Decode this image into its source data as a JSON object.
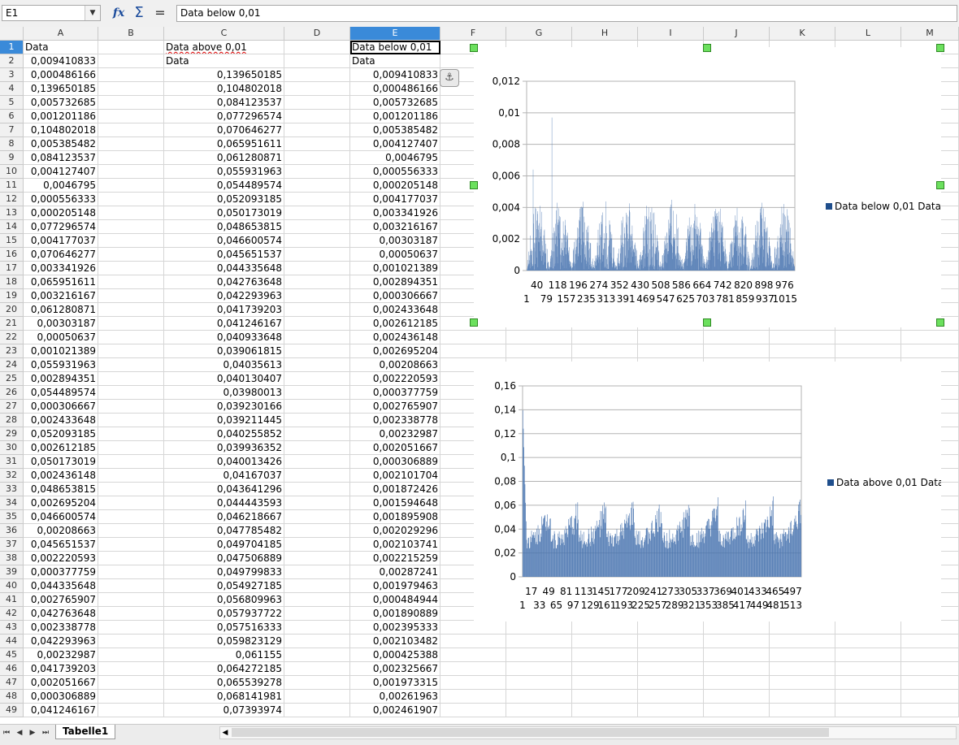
{
  "formula_bar": {
    "cell_ref": "E1",
    "content": "Data below 0,01",
    "dropdown_icon": "chevron-down-icon",
    "function_wizard_icon": "fx-icon",
    "sum_icon": "sigma-icon",
    "equals_icon": "equals-icon"
  },
  "columns": [
    "A",
    "B",
    "C",
    "D",
    "E",
    "F",
    "G",
    "H",
    "I",
    "J",
    "K",
    "L",
    "M"
  ],
  "selected_column": "E",
  "selected_row": "1",
  "row_numbers": [
    "1",
    "2",
    "3",
    "4",
    "5",
    "6",
    "7",
    "8",
    "9",
    "10",
    "11",
    "12",
    "13",
    "14",
    "15",
    "16",
    "17",
    "18",
    "19",
    "20",
    "21",
    "22",
    "23",
    "24",
    "25",
    "26",
    "27",
    "28",
    "29",
    "30",
    "31",
    "32",
    "33",
    "34",
    "35",
    "36",
    "37",
    "38",
    "39",
    "40",
    "41",
    "42",
    "43",
    "44",
    "45",
    "46",
    "47",
    "48",
    "49"
  ],
  "header_cells": {
    "a1": "Data",
    "c1": "Data above 0,01",
    "e1": "Data below 0,01",
    "c2": "Data",
    "e2": "Data",
    "a2": "0,009410833"
  },
  "column_a": [
    "0,000486166",
    "0,139650185",
    "0,005732685",
    "0,001201186",
    "0,104802018",
    "0,005385482",
    "0,084123537",
    "0,004127407",
    "0,0046795",
    "0,000556333",
    "0,000205148",
    "0,077296574",
    "0,004177037",
    "0,070646277",
    "0,003341926",
    "0,065951611",
    "0,003216167",
    "0,061280871",
    "0,00303187",
    "0,00050637",
    "0,001021389",
    "0,055931963",
    "0,002894351",
    "0,054489574",
    "0,000306667",
    "0,002433648",
    "0,052093185",
    "0,002612185",
    "0,050173019",
    "0,002436148",
    "0,048653815",
    "0,002695204",
    "0,046600574",
    "0,00208663",
    "0,045651537",
    "0,002220593",
    "0,000377759",
    "0,044335648",
    "0,002765907",
    "0,042763648",
    "0,002338778",
    "0,042293963",
    "0,00232987",
    "0,041739203",
    "0,002051667",
    "0,000306889",
    "0,041246167"
  ],
  "column_c": [
    "0,139650185",
    "0,104802018",
    "0,084123537",
    "0,077296574",
    "0,070646277",
    "0,065951611",
    "0,061280871",
    "0,055931963",
    "0,054489574",
    "0,052093185",
    "0,050173019",
    "0,048653815",
    "0,046600574",
    "0,045651537",
    "0,044335648",
    "0,042763648",
    "0,042293963",
    "0,041739203",
    "0,041246167",
    "0,040933648",
    "0,039061815",
    "0,04035613",
    "0,040130407",
    "0,03980013",
    "0,039230166",
    "0,039211445",
    "0,040255852",
    "0,039936352",
    "0,040013426",
    "0,04167037",
    "0,043641296",
    "0,044443593",
    "0,046218667",
    "0,047785482",
    "0,049704185",
    "0,047506889",
    "0,049799833",
    "0,054927185",
    "0,056809963",
    "0,057937722",
    "0,057516333",
    "0,059823129",
    "0,061155",
    "0,064272185",
    "0,065539278",
    "0,068141981",
    "0,07393974"
  ],
  "column_e": [
    "0,009410833",
    "0,000486166",
    "0,005732685",
    "0,001201186",
    "0,005385482",
    "0,004127407",
    "0,0046795",
    "0,000556333",
    "0,000205148",
    "0,004177037",
    "0,003341926",
    "0,003216167",
    "0,00303187",
    "0,00050637",
    "0,001021389",
    "0,002894351",
    "0,000306667",
    "0,002433648",
    "0,002612185",
    "0,002436148",
    "0,002695204",
    "0,00208663",
    "0,002220593",
    "0,000377759",
    "0,002765907",
    "0,002338778",
    "0,00232987",
    "0,002051667",
    "0,000306889",
    "0,002101704",
    "0,001872426",
    "0,001594648",
    "0,001895908",
    "0,002029296",
    "0,002103741",
    "0,002215259",
    "0,00287241",
    "0,001979463",
    "0,000484944",
    "0,001890889",
    "0,002395333",
    "0,002103482",
    "0,000425388",
    "0,002325667",
    "0,001973315",
    "0,00261963",
    "0,002461907"
  ],
  "sheet": {
    "tab_name": "Tabelle1",
    "nav_icons": [
      "first-sheet-icon",
      "prev-sheet-icon",
      "next-sheet-icon",
      "last-sheet-icon"
    ]
  },
  "colors": {
    "series": "#4a75b0",
    "legend_marker": "#1f4e8c",
    "selection": "#3a8ad9",
    "handle": "#6ce05e"
  },
  "chart_data": [
    {
      "type": "bar",
      "legend": "Data below 0,01 Data",
      "legend_position": "right",
      "ylim": [
        0,
        0.012
      ],
      "yticks": [
        "0,012",
        "0,01",
        "0,008",
        "0,006",
        "0,004",
        "0,002",
        "0"
      ],
      "xticks_row1": [
        "40",
        "118",
        "196",
        "274",
        "352",
        "430",
        "508",
        "586",
        "664",
        "742",
        "820",
        "898",
        "976"
      ],
      "xticks_row2": [
        "1",
        "79",
        "157",
        "235",
        "313",
        "391",
        "469",
        "547",
        "625",
        "703",
        "781",
        "859",
        "937",
        "1015"
      ],
      "n_points": 1015,
      "pattern": {
        "periods": 12,
        "peak": 0.0045,
        "trough": 0.0002,
        "spikes": [
          [
            24,
            0.0064
          ],
          [
            50,
            0.0041
          ],
          [
            95,
            0.0097
          ],
          [
            115,
            0.0043
          ]
        ]
      }
    },
    {
      "type": "bar",
      "legend": "Data above 0,01 Data",
      "legend_position": "right",
      "ylim": [
        0,
        0.16
      ],
      "yticks": [
        "0,16",
        "0,14",
        "0,12",
        "0,1",
        "0,08",
        "0,06",
        "0,04",
        "0,02",
        "0"
      ],
      "xticks_row1": [
        "17",
        "49",
        "81",
        "113",
        "145",
        "177",
        "209",
        "241",
        "273",
        "305",
        "337",
        "369",
        "401",
        "433",
        "465",
        "497"
      ],
      "xticks_row2": [
        "1",
        "33",
        "65",
        "97",
        "129",
        "161",
        "193",
        "225",
        "257",
        "289",
        "321",
        "353",
        "385",
        "417",
        "449",
        "481",
        "513"
      ],
      "n_points": 513,
      "pattern": {
        "first_value": 0.139650185,
        "periods": 10,
        "peak": 0.069,
        "trough": 0.039
      }
    }
  ]
}
